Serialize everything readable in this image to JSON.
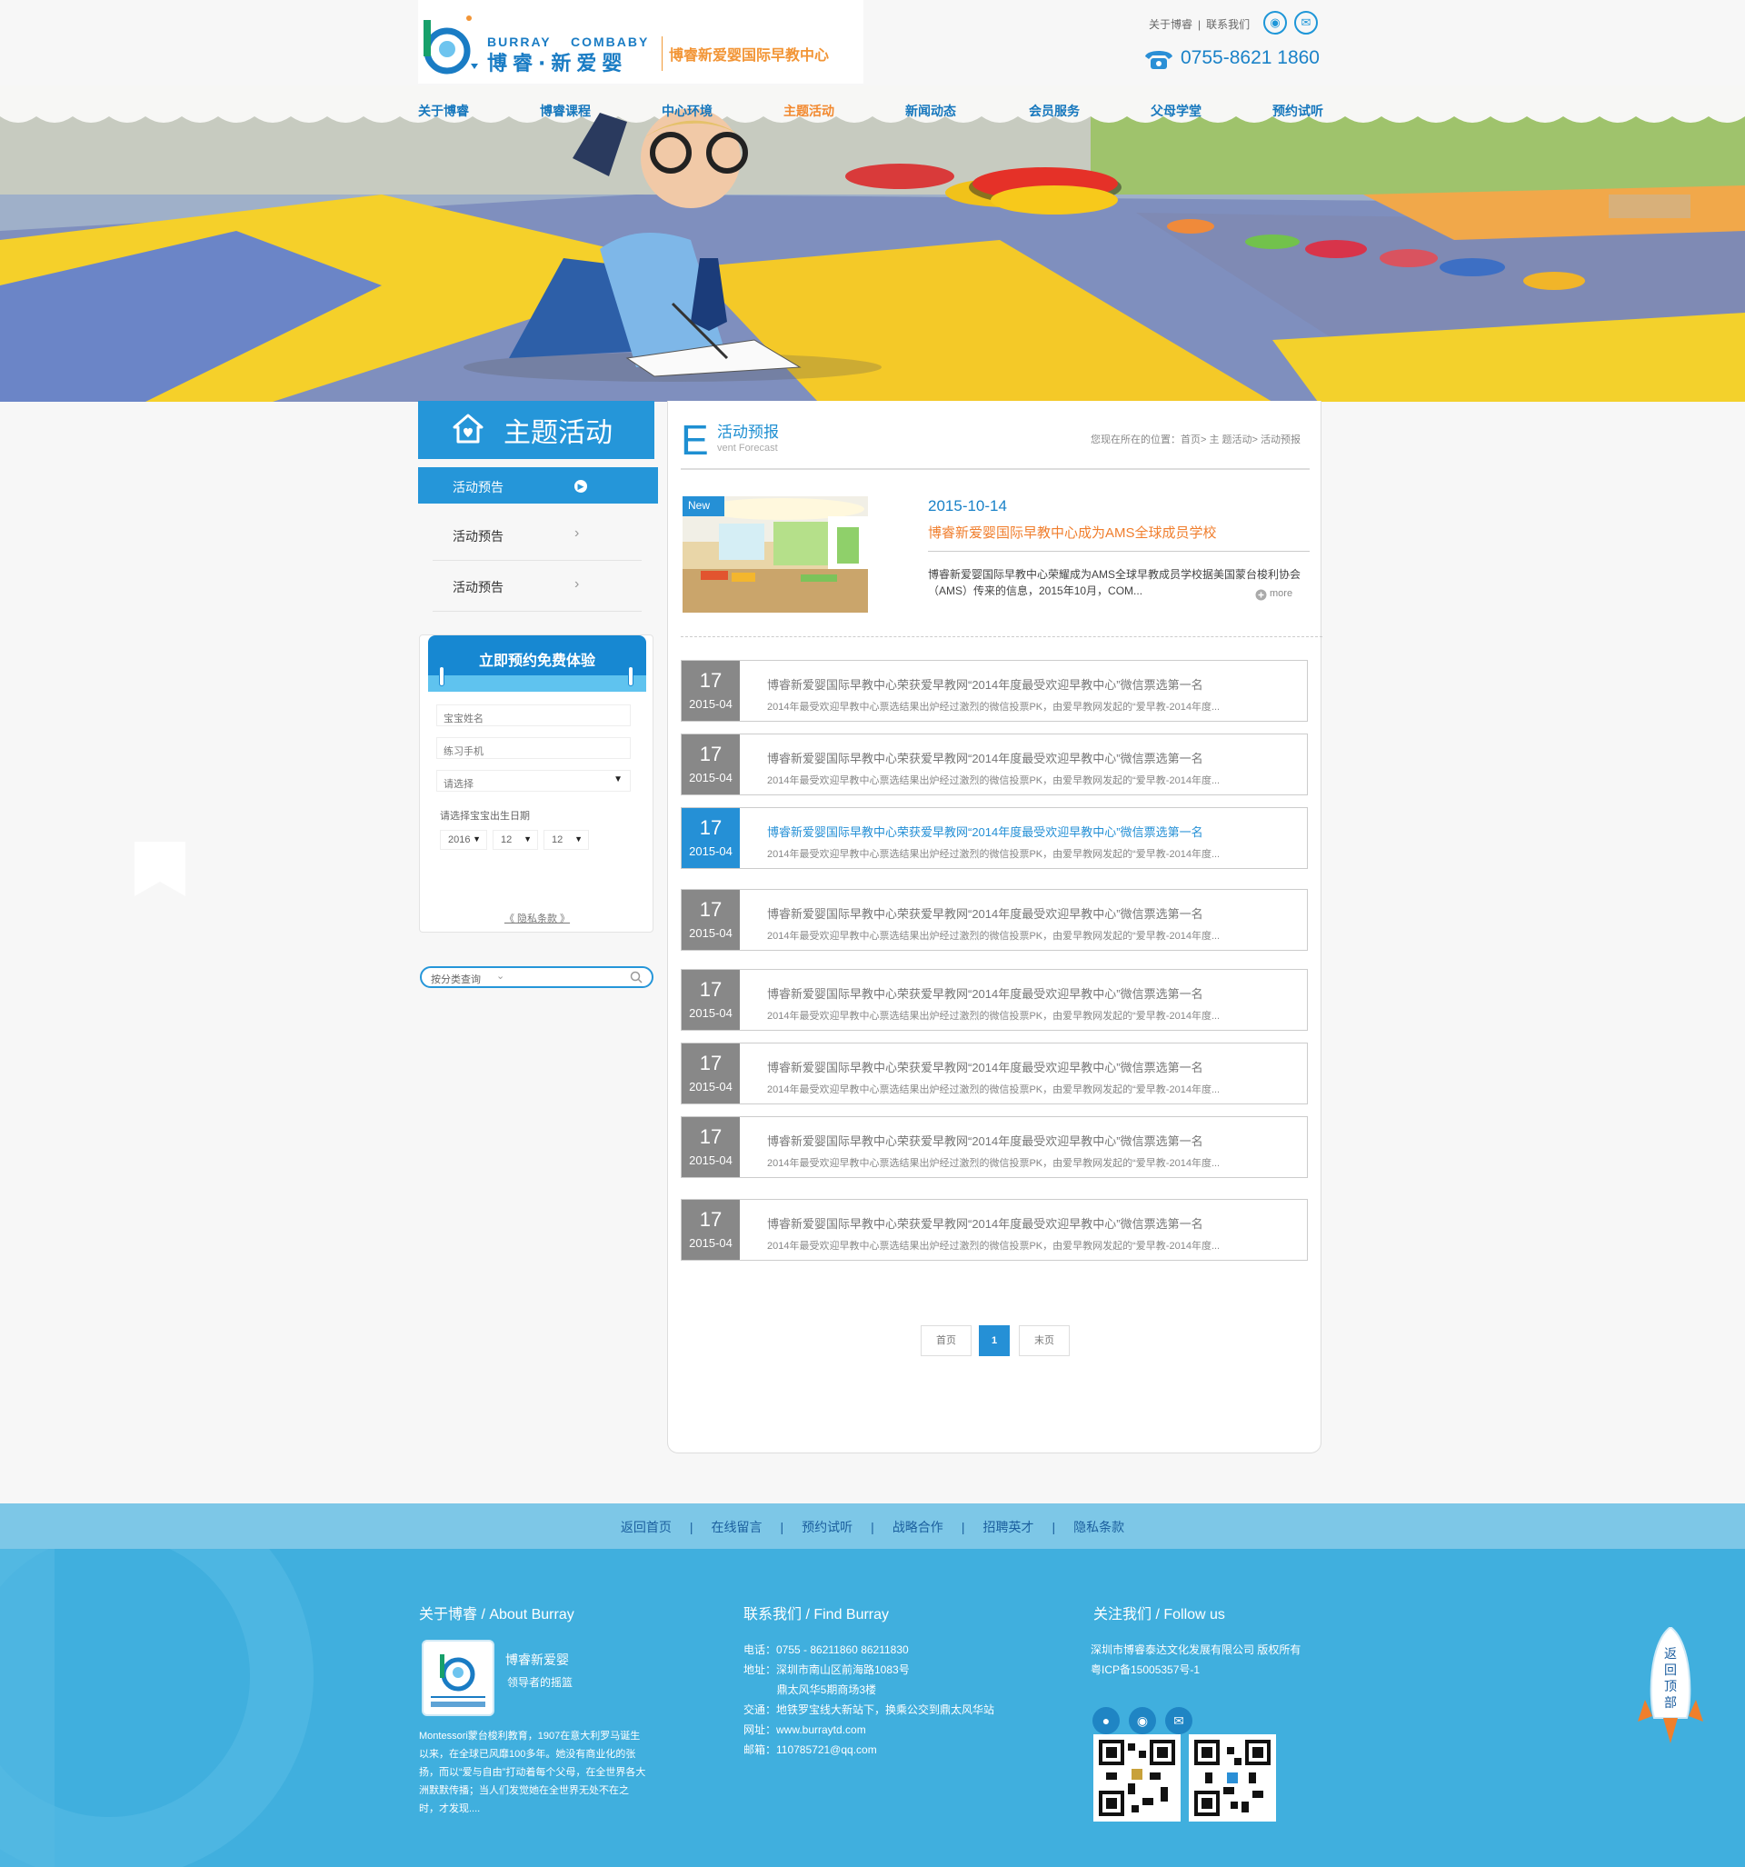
{
  "header": {
    "logo_en_left": "BURRAY",
    "logo_en_right": "COMBABY",
    "logo_cn": "博睿·新爱婴",
    "slogan": "博睿新爱婴国际早教中心",
    "top_links": [
      "关于博睿",
      "|",
      "联系我们"
    ],
    "phone": "0755-8621 1860"
  },
  "nav": {
    "items": [
      "关于博睿",
      "博睿课程",
      "中心环境",
      "主题活动",
      "新闻动态",
      "会员服务",
      "父母学堂",
      "预约试听"
    ],
    "active": "主题活动"
  },
  "sidebar": {
    "title": "主题活动",
    "items": [
      "活动预告",
      "活动预告",
      "活动预告"
    ],
    "booking": {
      "title": "立即预约免费体验",
      "baby_name_placeholder": "宝宝姓名",
      "phone_placeholder": "练习手机",
      "select_placeholder": "请选择",
      "birth_label": "请选择宝宝出生日期",
      "year": "2016",
      "month": "12",
      "day": "12",
      "privacy": "《 隐私条款 》"
    },
    "category_search": "按分类查询"
  },
  "content": {
    "letter": "E",
    "title": "活动预报",
    "subtitle": "vent Forecast",
    "breadcrumb": "您现在所在的位置：首页> 主 题活动>  活动预报",
    "feature": {
      "badge": "New",
      "date": "2015-10-14",
      "title": "博睿新爱婴国际早教中心成为AMS全球成员学校",
      "desc": "博睿新爱婴国际早教中心荣耀成为AMS全球早教成员学校据美国蒙台梭利协会（AMS）传来的信息，2015年10月，COM...",
      "more": "more"
    },
    "news": [
      {
        "day": "17",
        "ym": "2015-04",
        "title": "博睿新爱婴国际早教中心荣获爱早教网“2014年度最受欢迎早教中心”微信票选第一名",
        "summary": "2014年最受欢迎早教中心票选结果出炉经过激烈的微信投票PK，由爱早教网发起的“爱早教-2014年度..."
      },
      {
        "day": "17",
        "ym": "2015-04",
        "title": "博睿新爱婴国际早教中心荣获爱早教网“2014年度最受欢迎早教中心”微信票选第一名",
        "summary": "2014年最受欢迎早教中心票选结果出炉经过激烈的微信投票PK，由爱早教网发起的“爱早教-2014年度..."
      },
      {
        "day": "17",
        "ym": "2015-04",
        "title": "博睿新爱婴国际早教中心荣获爱早教网“2014年度最受欢迎早教中心”微信票选第一名",
        "summary": "2014年最受欢迎早教中心票选结果出炉经过激烈的微信投票PK，由爱早教网发起的“爱早教-2014年度...",
        "highlight": true
      },
      {
        "day": "17",
        "ym": "2015-04",
        "title": "博睿新爱婴国际早教中心荣获爱早教网“2014年度最受欢迎早教中心”微信票选第一名",
        "summary": "2014年最受欢迎早教中心票选结果出炉经过激烈的微信投票PK，由爱早教网发起的“爱早教-2014年度..."
      },
      {
        "day": "17",
        "ym": "2015-04",
        "title": "博睿新爱婴国际早教中心荣获爱早教网“2014年度最受欢迎早教中心”微信票选第一名",
        "summary": "2014年最受欢迎早教中心票选结果出炉经过激烈的微信投票PK，由爱早教网发起的“爱早教-2014年度..."
      },
      {
        "day": "17",
        "ym": "2015-04",
        "title": "博睿新爱婴国际早教中心荣获爱早教网“2014年度最受欢迎早教中心”微信票选第一名",
        "summary": "2014年最受欢迎早教中心票选结果出炉经过激烈的微信投票PK，由爱早教网发起的“爱早教-2014年度..."
      },
      {
        "day": "17",
        "ym": "2015-04",
        "title": "博睿新爱婴国际早教中心荣获爱早教网“2014年度最受欢迎早教中心”微信票选第一名",
        "summary": "2014年最受欢迎早教中心票选结果出炉经过激烈的微信投票PK，由爱早教网发起的“爱早教-2014年度..."
      },
      {
        "day": "17",
        "ym": "2015-04",
        "title": "博睿新爱婴国际早教中心荣获爱早教网“2014年度最受欢迎早教中心”微信票选第一名",
        "summary": "2014年最受欢迎早教中心票选结果出炉经过激烈的微信投票PK，由爱早教网发起的“爱早教-2014年度..."
      }
    ],
    "pager": {
      "first": "首页",
      "current": "1",
      "last": "末页"
    }
  },
  "footer": {
    "links": [
      "返回首页",
      "|",
      "在线留言",
      "|",
      "预约试听",
      "|",
      "战略合作",
      "|",
      "招聘英才",
      "|",
      "隐私条款"
    ],
    "about_head": "关于博睿 / About Burray",
    "about_name": "博睿新爱婴",
    "about_tag": "领导者的摇篮",
    "about_text": "Montessori蒙台梭利教育，1907在意大利罗马诞生以来，在全球已风靡100多年。她没有商业化的张扬，而以“爱与自由”打动着每个父母，在全世界各大洲默默传播；当人们发觉她在全世界无处不在之时，才发现....",
    "contact_head": "联系我们 / Find Burray",
    "contact_lines": [
      "电话：0755 - 86211860  86211830",
      "地址：深圳市南山区前海路1083号",
      "           鼎太风华5期商场3楼",
      "交通：地铁罗宝线大新站下，换乘公交到鼎太风华站",
      "网址：www.burraytd.com",
      "邮箱：110785721@qq.com"
    ],
    "follow_head": "关注我们 / Follow us",
    "follow_lines": [
      "深圳市博睿泰达文化发展有限公司 版权所有",
      "粤ICP备15005357号-1"
    ],
    "back_to_top": "返回顶部"
  },
  "colors": {
    "brand_blue": "#2596d9",
    "accent_orange": "#f2892f",
    "footer_blue": "#40afde"
  }
}
